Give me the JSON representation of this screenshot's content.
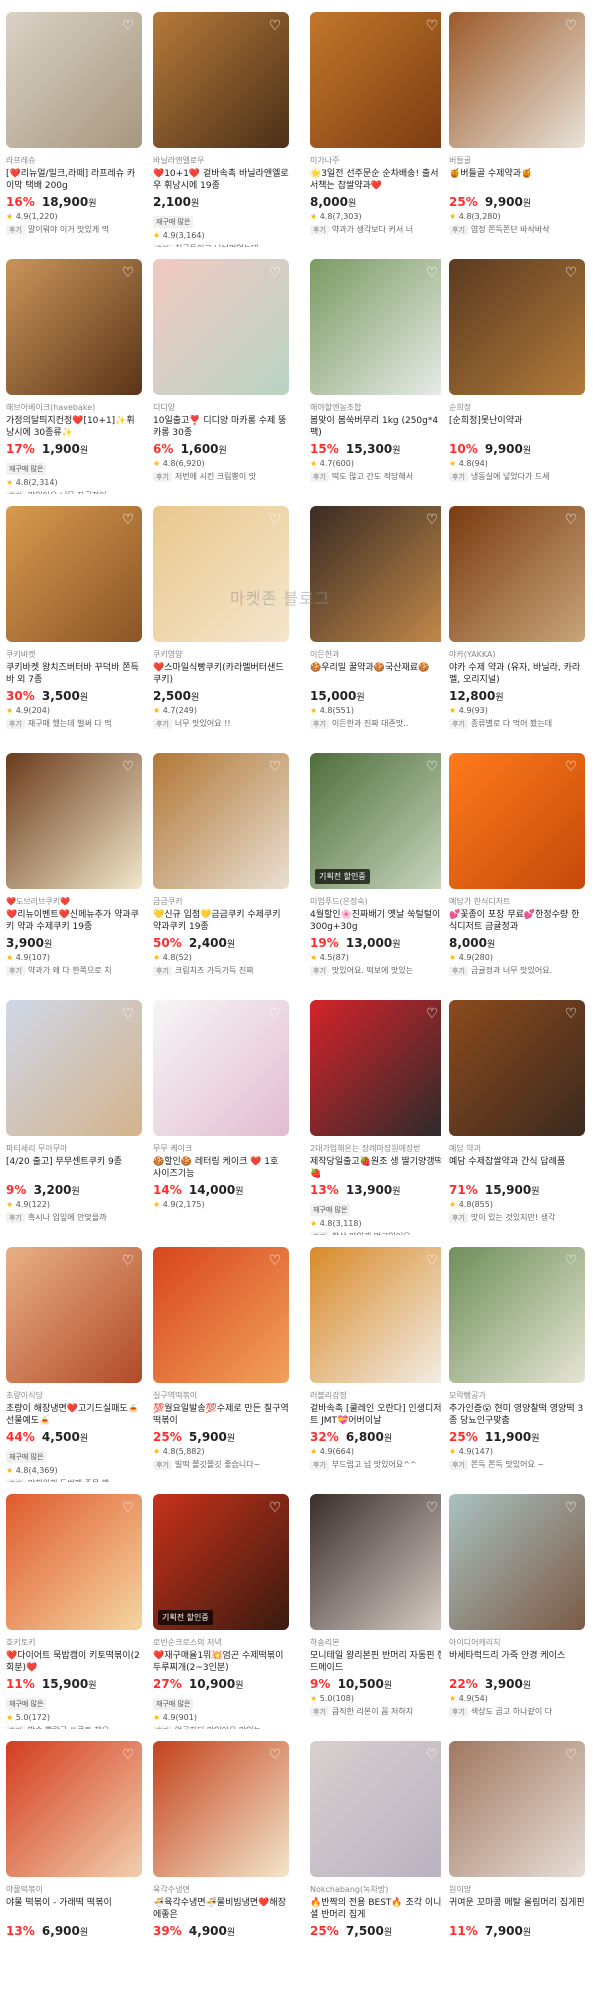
{
  "watermark": "마켓존 블로그",
  "products": [
    {
      "seller": "라프레슈",
      "name": "[❤️리뉴얼/밀크,라떼] 라프레슈 카이막 택배 200g",
      "discount": "16%",
      "price": "18,900",
      "unit": "원",
      "restock": "",
      "rating": "4.9",
      "count": "(1,220)",
      "review": "말이뭐야 이거 맛있게 먹",
      "colors": [
        "#d9d2c6",
        "#a7977f"
      ],
      "special": ""
    },
    {
      "seller": "바닐라앤엘로우",
      "name": "❤️10+1❤️ 겉바속촉 바닐라앤엘로우 휘낭시에 19종",
      "discount": "",
      "price": "2,100",
      "unit": "원",
      "restock": "재구매 많은",
      "rating": "4.9",
      "count": "(3,164)",
      "review": "친구들이고 나눠먹었는데",
      "colors": [
        "#b67a3a",
        "#4a2f18"
      ],
      "special": ""
    },
    {
      "seller": "미가나주",
      "name": "🌟3일전 선주문순 순차배송! 출서서책는 찹쌀약과❤️",
      "discount": "",
      "price": "8,000",
      "unit": "원",
      "restock": "",
      "rating": "4.8",
      "count": "(7,303)",
      "review": "약과가 생각보다 커서 너",
      "colors": [
        "#c2772b",
        "#7a3b11"
      ],
      "special": ""
    },
    {
      "seller": "버들골",
      "name": "🍯버들골 수제약과🍯",
      "discount": "25%",
      "price": "9,900",
      "unit": "원",
      "restock": "",
      "rating": "4.8",
      "count": "(3,280)",
      "review": "염정 쫀득쫀단 바삭바삭",
      "colors": [
        "#9b5a2a",
        "#e8e2d8"
      ],
      "special": ""
    },
    {
      "seller": "해브어베이크(havebake)",
      "name": "가정의달띄지컨정❤️[10+1]✨휘낭시에 30종류✨",
      "discount": "17%",
      "price": "1,900",
      "unit": "원",
      "restock": "재구매 많은",
      "rating": "4.8",
      "count": "(2,314)",
      "review": "맛있어요 너무 자극적이",
      "colors": [
        "#c9955a",
        "#5a3418"
      ],
      "special": ""
    },
    {
      "seller": "디디양",
      "name": "10일출고❣️ 디디양 마카롱 수제 뚱카롱 30종",
      "discount": "6%",
      "price": "1,600",
      "unit": "원",
      "restock": "",
      "rating": "4.8",
      "count": "(6,920)",
      "review": "저번에 시킨 크림뿡이 맛",
      "colors": [
        "#f1c9c3",
        "#b9d4c4"
      ],
      "special": ""
    },
    {
      "seller": "해야할엔농조합",
      "name": "봄맞이 봄쑥버무리 1kg (250g*4팩)",
      "discount": "15%",
      "price": "15,300",
      "unit": "원",
      "restock": "",
      "rating": "4.7",
      "count": "(600)",
      "review": "떡도 많고 간도 적당해서",
      "colors": [
        "#7a9a62",
        "#e9ecea"
      ],
      "special": ""
    },
    {
      "seller": "순희정",
      "name": "[순희정]못난이약과",
      "discount": "10%",
      "price": "9,900",
      "unit": "원",
      "restock": "",
      "rating": "4.8",
      "count": "(94)",
      "review": "냉동실에 넣었다가 드세",
      "colors": [
        "#5b3a20",
        "#b07a3a"
      ],
      "special": ""
    },
    {
      "seller": "쿠키바켓",
      "name": "쿠키바켓 왕치즈버터바 꾸덕바 쫀득바 외 7종",
      "discount": "30%",
      "price": "3,500",
      "unit": "원",
      "restock": "",
      "rating": "4.9",
      "count": "(204)",
      "review": "재구매 했는데 벌써 다 먹",
      "colors": [
        "#d89a4f",
        "#8a5526"
      ],
      "special": ""
    },
    {
      "seller": "쿠키영양",
      "name": "❤️스마일식빵쿠키(카라멜버터샌드쿠키)",
      "discount": "",
      "price": "2,500",
      "unit": "원",
      "restock": "",
      "rating": "4.7",
      "count": "(249)",
      "review": "너무 맛있어요 !!",
      "colors": [
        "#e9c88e",
        "#f4e6cc"
      ],
      "special": ""
    },
    {
      "seller": "이든한과",
      "name": "🍪우리밀 꿀약과🍪국산재료🍪",
      "discount": "",
      "price": "15,000",
      "unit": "원",
      "restock": "",
      "rating": "4.8",
      "count": "(551)",
      "review": "이든한과 진짜 대존맛..",
      "colors": [
        "#3a2b24",
        "#c28a49"
      ],
      "special": ""
    },
    {
      "seller": "야카(YAKKA)",
      "name": "야카 수제 약과 (유자, 바닐라, 카라멜, 오리지널)",
      "discount": "",
      "price": "12,800",
      "unit": "원",
      "restock": "",
      "rating": "4.9",
      "count": "(93)",
      "review": "종류별로 다 먹어 봤는데",
      "colors": [
        "#7a3b12",
        "#c8a57a"
      ],
      "special": ""
    },
    {
      "seller": "❤️도브러브쿠키❤️",
      "name": "❤️리뉴이벤트❤️신메뉴추가 약과쿠키 약과 수제쿠키 19종",
      "discount": "",
      "price": "3,900",
      "unit": "원",
      "restock": "",
      "rating": "4.9",
      "count": "(107)",
      "review": "약과가 왜 다 한쪽으로 치",
      "colors": [
        "#6b3b1c",
        "#f1e7c9"
      ],
      "special": ""
    },
    {
      "seller": "금금쿠키",
      "name": "💛신규 입점💛금금쿠키 수제쿠키 약과쿠키 19종",
      "discount": "50%",
      "price": "2,400",
      "unit": "원",
      "restock": "",
      "rating": "4.8",
      "count": "(52)",
      "review": "크림치즈 가득가득 진짜",
      "colors": [
        "#b27836",
        "#e8dfd2"
      ],
      "special": ""
    },
    {
      "seller": "미엄푸드(은정숙)",
      "name": "4월할인🌸진짜배기 옛날 쑥털털이300g+30g",
      "discount": "19%",
      "price": "13,000",
      "unit": "원",
      "restock": "",
      "rating": "4.5",
      "count": "(87)",
      "review": "맛있어요. 떡보에 맛있는",
      "colors": [
        "#4f6e3b",
        "#c9d7c0"
      ],
      "special": "기획전 할인중"
    },
    {
      "seller": "예담가 한식디저트",
      "name": "💕꽃종이 포장 무료💕한정수량 한식디저트 금귤정과",
      "discount": "",
      "price": "8,000",
      "unit": "원",
      "restock": "",
      "rating": "4.9",
      "count": "(280)",
      "review": "금귤정과 너무 맛있어요.",
      "colors": [
        "#ff7a1a",
        "#c44a0c"
      ],
      "special": ""
    },
    {
      "seller": "파티세리 무아무아",
      "name": "[4/20 출고] 무무센트쿠키 9종",
      "discount": "9%",
      "price": "3,200",
      "unit": "원",
      "restock": "",
      "rating": "4.9",
      "count": "(122)",
      "review": "흑시나 입잎에 안맞을까",
      "colors": [
        "#cfd7e8",
        "#d3b38c"
      ],
      "special": ""
    },
    {
      "seller": "무무 케이크",
      "name": "🍪할인🍪 레터링 케이크 ❤️ 1호 사이즈기능",
      "discount": "14%",
      "price": "14,000",
      "unit": "원",
      "restock": "",
      "rating": "4.9",
      "count": "(2,175)",
      "review": "",
      "colors": [
        "#f6f6f6",
        "#e2bcd0"
      ],
      "special": ""
    },
    {
      "seller": "2대가업해온는 장례마장원에장받",
      "name": "제작당일출고🍓원조 생 딸기양갱떡🍓",
      "discount": "13%",
      "price": "13,900",
      "unit": "원",
      "restock": "재구매 많은",
      "rating": "4.8",
      "count": "(3,118)",
      "review": "항상 맛있게 먹고있어요.",
      "colors": [
        "#d4232b",
        "#2b2b2b"
      ],
      "special": ""
    },
    {
      "seller": "예담 약과",
      "name": "예담 수제찹쌀약과 간식 답례품",
      "discount": "71%",
      "price": "15,900",
      "unit": "원",
      "restock": "",
      "rating": "4.8",
      "count": "(855)",
      "review": "맛이 있는 것있지만! 생각",
      "colors": [
        "#8c4a1c",
        "#3a2a20"
      ],
      "special": ""
    },
    {
      "seller": "초량이식당",
      "name": "초량이 해장냉면❤️고기드실패도🍝선물예도🍝",
      "discount": "44%",
      "price": "4,500",
      "unit": "원",
      "restock": "재구매 많은",
      "rating": "4.8",
      "count": "(4,369)",
      "review": "망해워해 두번째 주문 했",
      "colors": [
        "#e8b087",
        "#b14a27"
      ],
      "special": ""
    },
    {
      "seller": "실구역떡볶이",
      "name": "💯월요일발송💯수제로 만든 칠구역떡볶이",
      "discount": "25%",
      "price": "5,900",
      "unit": "원",
      "restock": "",
      "rating": "4.8",
      "count": "(5,882)",
      "review": "빌떡 쫄깃쫄깃 좋습니다~",
      "colors": [
        "#d8451d",
        "#f2a15c"
      ],
      "special": ""
    },
    {
      "seller": "러블리강정",
      "name": "겉바속촉 [쿨레인 오란다] 인생디저트 JMT💝어버이날",
      "discount": "32%",
      "price": "6,800",
      "unit": "원",
      "restock": "",
      "rating": "4.9",
      "count": "(664)",
      "review": "부드럽고 넘 맛있어요^^",
      "colors": [
        "#d88a2a",
        "#f2efe8"
      ],
      "special": ""
    },
    {
      "seller": "모락빵공가",
      "name": "추가인증😮 현미 영양찰떡 영양떡 3종 당뇨인구맞춤",
      "discount": "25%",
      "price": "11,900",
      "unit": "원",
      "restock": "",
      "rating": "4.9",
      "count": "(147)",
      "review": "쫀득 쫀득 맛있어요 ~",
      "colors": [
        "#6f8f5a",
        "#e6e4d4"
      ],
      "special": ""
    },
    {
      "seller": "호키토키",
      "name": "❤️다이어트 묵밥캠이 키토떡볶이(2회분)❤️",
      "discount": "11%",
      "price": "15,900",
      "unit": "원",
      "restock": "재구매 많은",
      "rating": "5.0",
      "count": "(172)",
      "review": "발송 빨랑구 쏘큐트 해요",
      "colors": [
        "#e05a2e",
        "#f5d6a2"
      ],
      "special": ""
    },
    {
      "seller": "로빈순크로스의 저녁",
      "name": "❤️재구매율1위💥엄곤 수제떡볶이 두루찌개(2~3인분)",
      "discount": "27%",
      "price": "10,900",
      "unit": "원",
      "restock": "재구매 많은",
      "rating": "4.9",
      "count": "(901)",
      "review": "엄곤하티 맛있어요 맛있는",
      "colors": [
        "#c8321a",
        "#3a1a10"
      ],
      "special": "기획전 할인중"
    },
    {
      "seller": "하송리본",
      "name": "모니테일 왕리본핀 반머리 자동핀 핸드메이드",
      "discount": "9%",
      "price": "10,500",
      "unit": "원",
      "restock": "",
      "rating": "5.0",
      "count": "(108)",
      "review": "큼직한 리본이 꼼 저하지",
      "colors": [
        "#3a2e2b",
        "#d8cfc8"
      ],
      "special": ""
    },
    {
      "seller": "아이디어캐리지",
      "name": "바세타럭드리 가죽 안경 케이스",
      "discount": "22%",
      "price": "3,900",
      "unit": "원",
      "restock": "",
      "rating": "4.9",
      "count": "(54)",
      "review": "색상도 곱고 하나같이 다",
      "colors": [
        "#a9c2c0",
        "#7b5a46"
      ],
      "special": ""
    },
    {
      "seller": "야물떡볶이",
      "name": "야물 떡볶이 - 가래떡 떡볶이",
      "discount": "13%",
      "price": "6,900",
      "unit": "원",
      "restock": "",
      "rating": "",
      "count": "",
      "review": "",
      "colors": [
        "#d33c1e",
        "#f1cfae"
      ],
      "special": ""
    },
    {
      "seller": "육각수냉면",
      "name": "🍜육각수냉면🍜물비빔냉면❤️해장에좋은",
      "discount": "39%",
      "price": "4,900",
      "unit": "원",
      "restock": "",
      "rating": "",
      "count": "",
      "review": "",
      "colors": [
        "#c4421c",
        "#f3e6cc"
      ],
      "special": ""
    },
    {
      "seller": "Nokchabang(녹차방)",
      "name": "🔥반짝의 전용 BEST🔥 조각 이니셜 반머리 집게",
      "discount": "25%",
      "price": "7,500",
      "unit": "원",
      "restock": "",
      "rating": "",
      "count": "",
      "review": "",
      "colors": [
        "#d8cfcf",
        "#b9b2c0"
      ],
      "special": ""
    },
    {
      "seller": "원이망",
      "name": "귀여운 꼬마콩 메탈 올림머리 집게핀",
      "discount": "11%",
      "price": "7,900",
      "unit": "원",
      "restock": "",
      "rating": "",
      "count": "",
      "review": "",
      "colors": [
        "#a07860",
        "#e6ded8"
      ],
      "special": ""
    }
  ],
  "labels": {
    "review_tag": "후기"
  }
}
